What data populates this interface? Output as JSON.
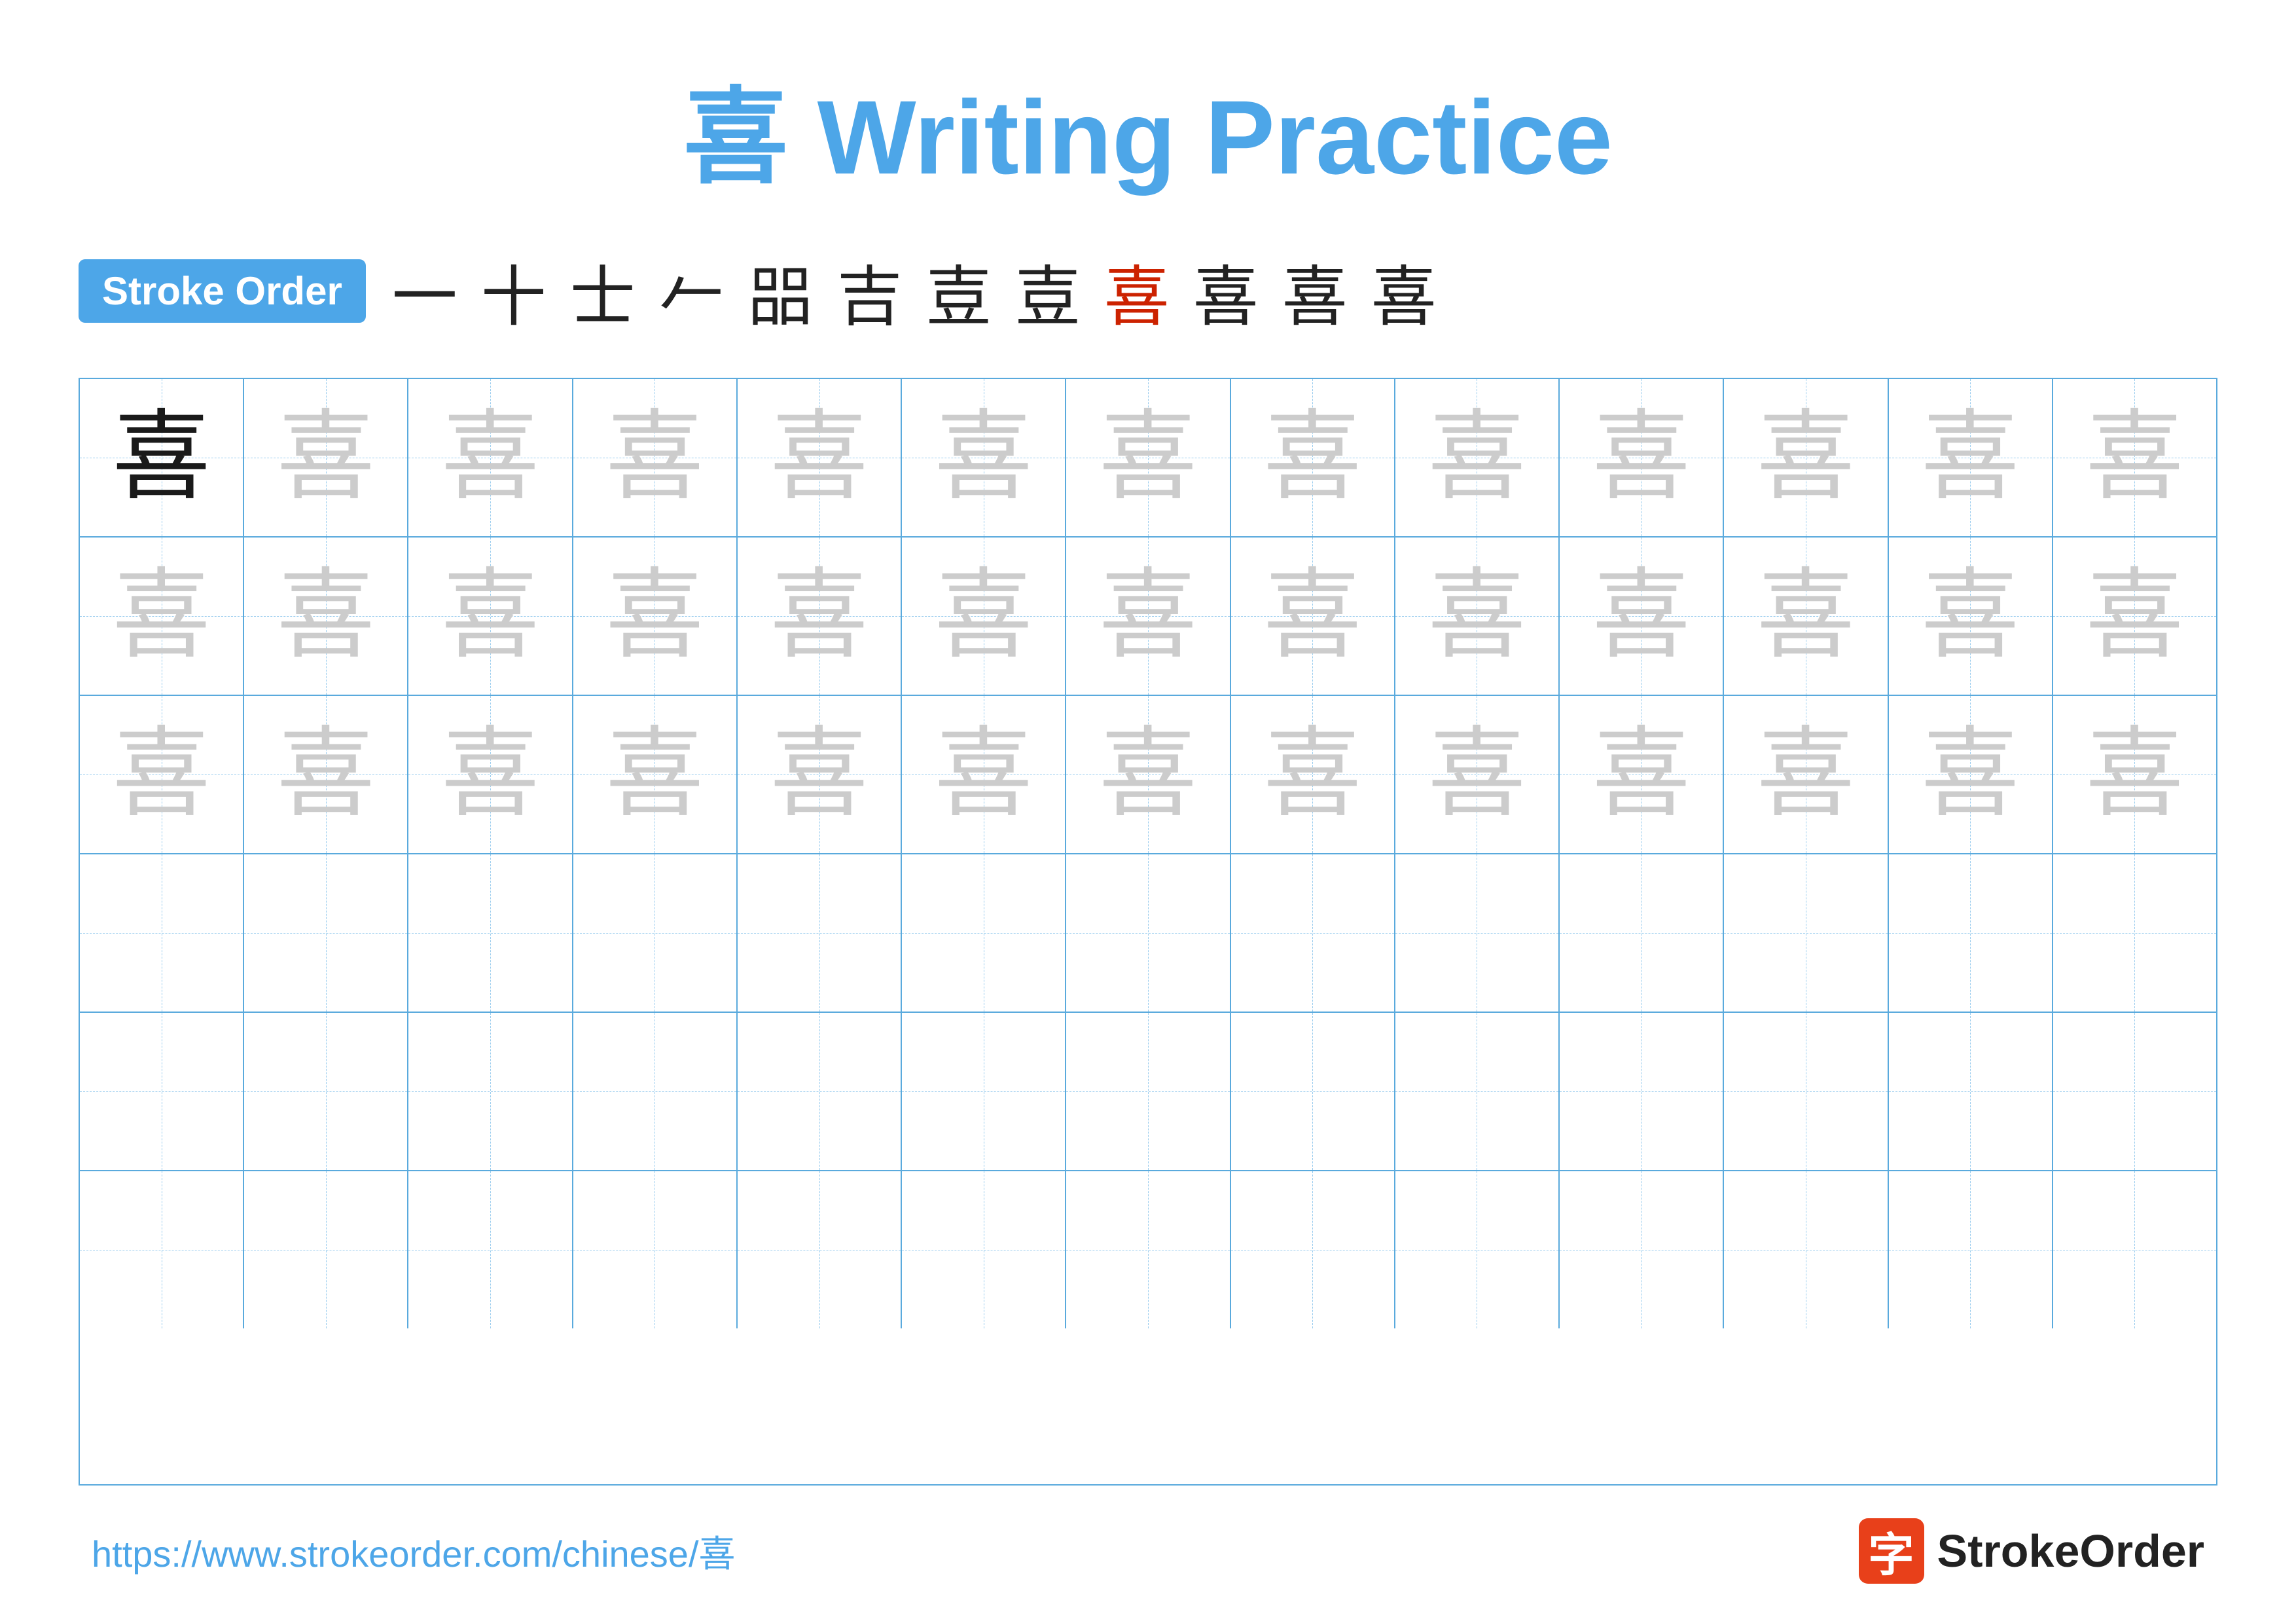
{
  "title": {
    "char": "喜",
    "text": "Writing Practice",
    "full": "喜 Writing Practice"
  },
  "stroke_order": {
    "badge_label": "Stroke Order",
    "strokes": [
      {
        "char": "一",
        "red": false
      },
      {
        "char": "十",
        "red": false
      },
      {
        "char": "士",
        "red": false
      },
      {
        "char": "𠂉",
        "red": false
      },
      {
        "char": "㗊",
        "red": false
      },
      {
        "char": "吉",
        "red": false
      },
      {
        "char": "吉",
        "red": false
      },
      {
        "char": "壴",
        "red": false
      },
      {
        "char": "喜",
        "red": true
      },
      {
        "char": "喜",
        "red": false
      },
      {
        "char": "喜",
        "red": false
      },
      {
        "char": "喜",
        "red": false
      }
    ]
  },
  "grid": {
    "rows": 6,
    "cols": 13,
    "char": "喜",
    "practice_rows": [
      [
        1,
        2,
        2,
        2,
        2,
        2,
        2,
        2,
        2,
        2,
        2,
        2,
        2
      ],
      [
        2,
        2,
        2,
        2,
        2,
        2,
        2,
        2,
        2,
        2,
        2,
        2,
        2
      ],
      [
        2,
        2,
        2,
        2,
        2,
        2,
        2,
        2,
        2,
        2,
        2,
        2,
        2
      ],
      [
        0,
        0,
        0,
        0,
        0,
        0,
        0,
        0,
        0,
        0,
        0,
        0,
        0
      ],
      [
        0,
        0,
        0,
        0,
        0,
        0,
        0,
        0,
        0,
        0,
        0,
        0,
        0
      ],
      [
        0,
        0,
        0,
        0,
        0,
        0,
        0,
        0,
        0,
        0,
        0,
        0,
        0
      ]
    ]
  },
  "footer": {
    "url": "https://www.strokeorder.com/chinese/喜",
    "logo_char": "字",
    "logo_text": "StrokeOrder"
  }
}
